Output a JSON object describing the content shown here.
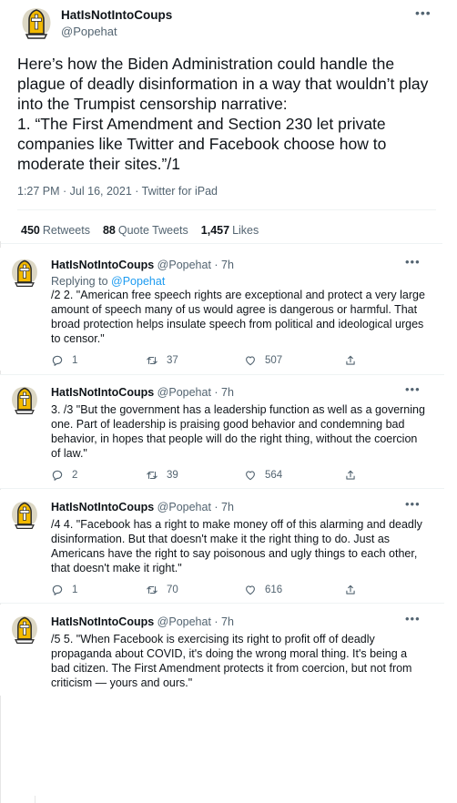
{
  "main_tweet": {
    "display_name": "HatIsNotIntoCoups",
    "handle": "@Popehat",
    "body": "Here’s how the Biden Administration could handle the plague of deadly disinformation in a way that wouldn’t play into the Trumpist censorship narrative:\n1. “The First Amendment and Section 230 let private companies like Twitter and Facebook choose how to moderate their sites.”/1",
    "meta": "1:27 PM · Jul 16, 2021 · Twitter for iPad",
    "retweets_count": "450",
    "retweets_label": "Retweets",
    "quotes_count": "88",
    "quotes_label": "Quote Tweets",
    "likes_count": "1,457",
    "likes_label": "Likes"
  },
  "replies": [
    {
      "display_name": "HatIsNotIntoCoups",
      "handle_time": "@Popehat · 7h",
      "replying_prefix": "Replying to",
      "replying_handle": "@Popehat",
      "text": "/2 2. \"American free speech rights are exceptional and protect a very large amount of speech many of us would agree is dangerous or harmful.  That broad protection helps insulate speech from political and ideological urges to censor.\"",
      "reply_count": "1",
      "retweet_count": "37",
      "like_count": "507"
    },
    {
      "display_name": "HatIsNotIntoCoups",
      "handle_time": "@Popehat · 7h",
      "text": "3.  /3 \"But the government has a leadership function as well as a governing one.  Part of leadership is praising good behavior and condemning bad behavior, in hopes that people will do the right thing, without the coercion of law.\"",
      "reply_count": "2",
      "retweet_count": "39",
      "like_count": "564"
    },
    {
      "display_name": "HatIsNotIntoCoups",
      "handle_time": "@Popehat · 7h",
      "text": "/4 4. \"Facebook has a right to make money off of this alarming and deadly disinformation. But that doesn't make it the right thing to do. Just as Americans have the right to say poisonous and ugly things to each other, that doesn't make it right.\"",
      "reply_count": "1",
      "retweet_count": "70",
      "like_count": "616"
    },
    {
      "display_name": "HatIsNotIntoCoups",
      "handle_time": "@Popehat · 7h",
      "text": "/5 5. \"When Facebook is exercising its right to profit off of deadly propaganda about COVID, it's doing the wrong moral thing.  It's being a bad citizen. The First Amendment protects it from coercion, but not from criticism — yours and ours.\""
    }
  ],
  "colors": {
    "text": "#0f1419",
    "secondary": "#536471",
    "link": "#1d9bf0",
    "avatar_blob": "#dcd7c4",
    "avatar_hat": "#f2b900",
    "avatar_cross": "#ffffff"
  },
  "icons": [
    "avatar-hat-icon",
    "more-icon",
    "reply-icon",
    "retweet-icon",
    "like-icon",
    "share-icon"
  ]
}
